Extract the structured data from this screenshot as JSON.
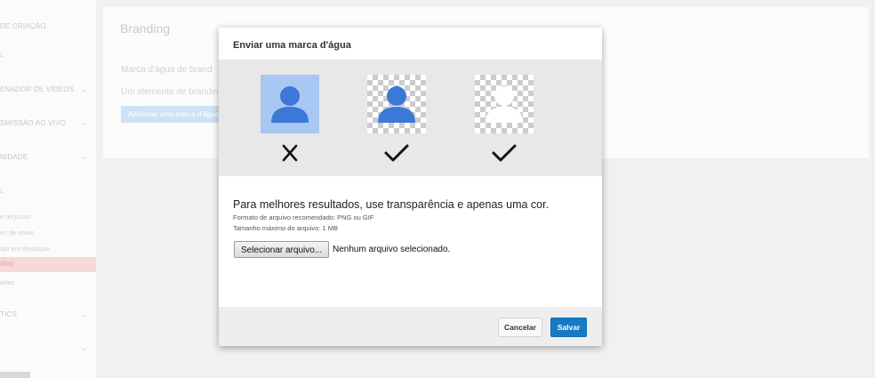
{
  "sidebar": {
    "items": [
      {
        "label": "DE CRIAÇÃO",
        "type": "section"
      },
      {
        "label": "L",
        "type": "sub"
      },
      {
        "label": "ENADOR DE VÍDEOS",
        "type": "section"
      },
      {
        "label": "SMISSÃO AO VIVO",
        "type": "section"
      },
      {
        "label": "NIDADE",
        "type": "section"
      },
      {
        "label": "L",
        "type": "sub"
      },
      {
        "label": "e recursos",
        "type": "sub"
      },
      {
        "label": "es de envio",
        "type": "sub"
      },
      {
        "label": "ído em destaque",
        "type": "sub"
      },
      {
        "label": "ding",
        "type": "active"
      },
      {
        "label": "adas",
        "type": "sub"
      },
      {
        "label": "TICS",
        "type": "section"
      }
    ]
  },
  "page": {
    "title": "Branding",
    "watermark_label": "Marca d'água de brand",
    "description": "Um elemento de branding",
    "add_button": "Adicionar uma marca d'água"
  },
  "dialog": {
    "title": "Enviar uma marca d'água",
    "examples": [
      {
        "style": "solid background",
        "result": "x-icon",
        "icon_color": "#3c78d8"
      },
      {
        "style": "transparent background",
        "result": "check-icon",
        "icon_color": "#3c78d8"
      },
      {
        "style": "transparent background, white",
        "result": "check-icon",
        "icon_color": "#ffffff"
      }
    ],
    "headline": "Para melhores resultados, use transparência e apenas uma cor.",
    "format_note": "Formato de arquivo recomendado: PNG ou GIF",
    "size_note": "Tamanho máximo do arquivo: 1 MB",
    "file_button": "Selecionar arquivo...",
    "file_status": "Nenhum arquivo selecionado.",
    "cancel": "Cancelar",
    "save": "Salvar"
  },
  "colors": {
    "accent": "#167ac6",
    "preview_bg": "#e8e8e8",
    "person_blue": "#3c78d8",
    "thumb_blue": "#a9c7f3"
  }
}
